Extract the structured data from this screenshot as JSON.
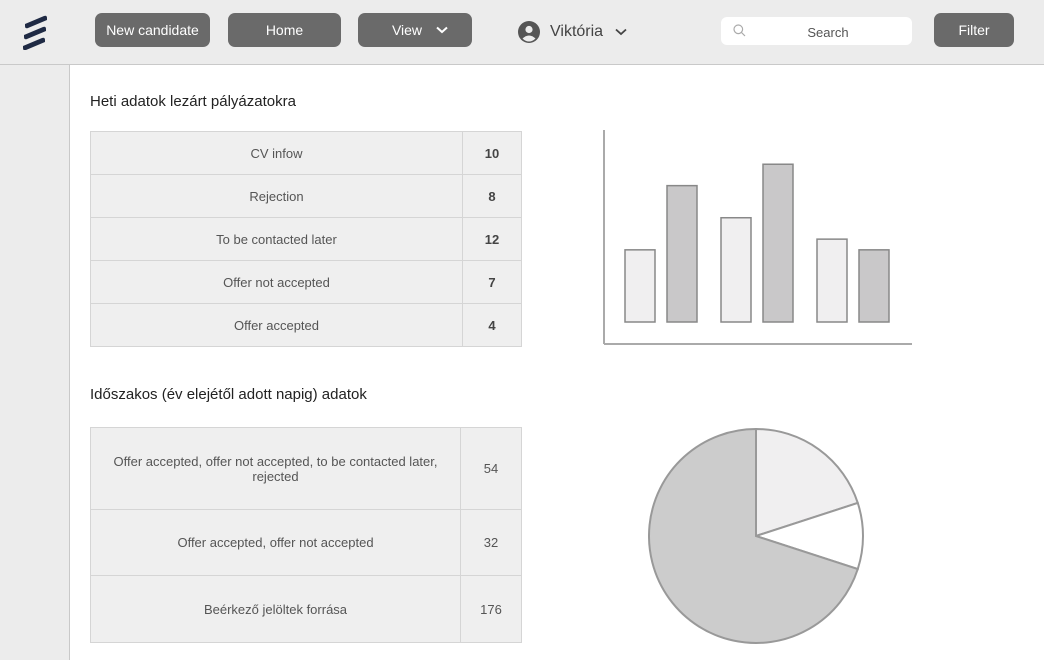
{
  "topbar": {
    "logo_icon": "ericsson-logo",
    "new_candidate_label": "New candidate",
    "home_label": "Home",
    "view_label": "View",
    "user_name": "Viktória",
    "search_placeholder": "Search",
    "filter_label": "Filter"
  },
  "main": {
    "section1_title": "Heti adatok lezárt pályázatokra",
    "weekly_rows": [
      {
        "label": "CV infow",
        "value": "10"
      },
      {
        "label": "Rejection",
        "value": "8"
      },
      {
        "label": "To be contacted later",
        "value": "12"
      },
      {
        "label": "Offer not accepted",
        "value": "7"
      },
      {
        "label": "Offer accepted",
        "value": "4"
      }
    ],
    "section2_title": "Időszakos (év elejétől adott napig) adatok",
    "period_rows": [
      {
        "label": "Offer accepted, offer not accepted, to be contacted later, rejected",
        "value": "54"
      },
      {
        "label": "Offer accepted, offer not accepted",
        "value": "32"
      },
      {
        "label": "Beérkező jelöltek forrása",
        "value": "176"
      }
    ]
  },
  "colors": {
    "button_bg": "#6a6a6a",
    "bar_light": "#f0eff0",
    "bar_dark": "#c9c8c9",
    "pie_large": "#cccccc",
    "pie_light": "#f0eff0",
    "pie_white": "#ffffff"
  },
  "chart_data": [
    {
      "type": "bar",
      "categories": [
        "",
        "",
        "",
        "",
        "",
        ""
      ],
      "values": [
        44,
        74,
        59,
        84,
        49,
        44
      ],
      "ylim": [
        0,
        100
      ],
      "title": "",
      "xlabel": "",
      "ylabel": ""
    },
    {
      "type": "pie",
      "labels": [
        "",
        "",
        ""
      ],
      "values": [
        20,
        10,
        70
      ],
      "title": ""
    }
  ]
}
